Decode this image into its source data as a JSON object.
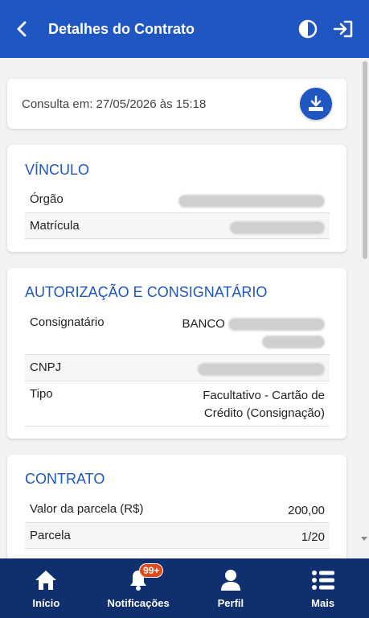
{
  "header": {
    "title": "Detalhes do Contrato",
    "back_icon": "chevron-left-icon",
    "contrast_icon": "contrast-icon",
    "logout_icon": "logout-icon"
  },
  "consulta": {
    "text": "Consulta em: 27/05/2026 às 15:18",
    "download_icon": "download-icon"
  },
  "vinculo": {
    "title": "VÍNCULO",
    "rows": [
      {
        "label": "Órgão"
      },
      {
        "label": "Matrícula"
      }
    ]
  },
  "autorizacao": {
    "title": "AUTORIZAÇÃO E CONSIGNATÁRIO",
    "consignatario_label": "Consignatário",
    "consignatario_value_prefix": "BANCO",
    "cnpj_label": "CNPJ",
    "tipo_label": "Tipo",
    "tipo_value_line1": "Facultativo - Cartão de",
    "tipo_value_line2": "Crédito (Consignação)"
  },
  "contrato": {
    "title": "CONTRATO",
    "rows": [
      {
        "label": "Valor da parcela (R$)",
        "value": "200,00"
      },
      {
        "label": "Parcela",
        "value": "1/20"
      }
    ]
  },
  "nav": {
    "items": [
      {
        "label": "Início",
        "icon": "home-icon"
      },
      {
        "label": "Notificações",
        "icon": "bell-icon",
        "badge": "99+"
      },
      {
        "label": "Perfil",
        "icon": "user-icon"
      },
      {
        "label": "Mais",
        "icon": "menu-list-icon"
      }
    ]
  },
  "colors": {
    "header": "#1f56c2",
    "nav": "#0f2f6e",
    "accent": "#1f56c2",
    "badge": "#e04a1a"
  }
}
